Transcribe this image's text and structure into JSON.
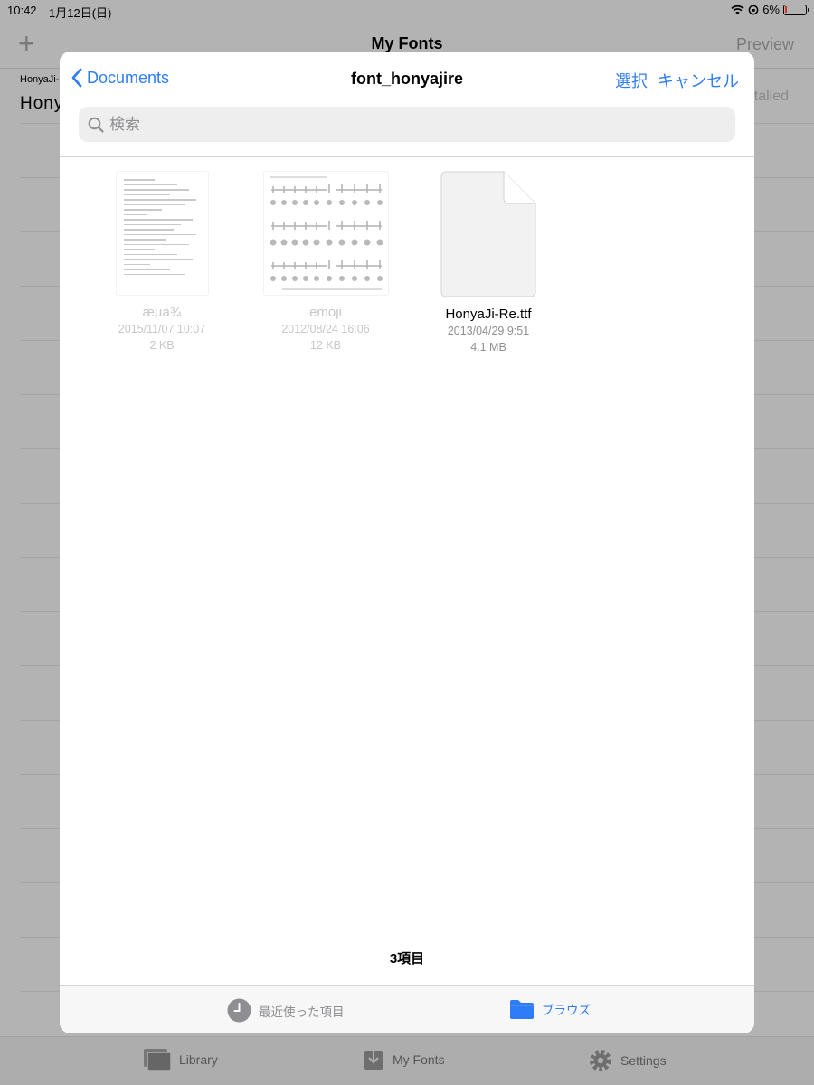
{
  "status_bar": {
    "time": "10:42",
    "date": "1月12日(日)",
    "battery": "6%"
  },
  "background_app": {
    "title": "My Fonts",
    "preview_label": "Preview",
    "row_small": "HonyaJi-",
    "row_big": "Hony",
    "installed_label": "talled",
    "tabs": [
      {
        "label": "Library",
        "icon": "library-icon"
      },
      {
        "label": "My Fonts",
        "icon": "download-icon"
      },
      {
        "label": "Settings",
        "icon": "gear-icon"
      }
    ]
  },
  "picker": {
    "back_label": "Documents",
    "title": "font_honyajire",
    "select_label": "選択",
    "cancel_label": "キャンセル",
    "search_placeholder": "検索",
    "files": [
      {
        "name": "æµà¾",
        "date": "2015/11/07 10:07",
        "size": "2 KB",
        "enabled": false,
        "icon": "text-document-thumbnail"
      },
      {
        "name": "emoji",
        "date": "2012/08/24 16:06",
        "size": "12 KB",
        "enabled": false,
        "icon": "emoji-chart-thumbnail"
      },
      {
        "name": "HonyaJi-Re.ttf",
        "date": "2013/04/29 9:51",
        "size": "4.1 MB",
        "enabled": true,
        "icon": "blank-file-icon"
      }
    ],
    "item_count": "3項目",
    "tabs": [
      {
        "label": "最近使った項目",
        "icon": "clock-icon",
        "active": false
      },
      {
        "label": "ブラウズ",
        "icon": "folder-icon",
        "active": true
      }
    ]
  },
  "colors": {
    "accent": "#2f7df6",
    "dimmed_text": "#c7c7cc",
    "secondary_text": "#8e8e93",
    "overlay": "#b3b3b3"
  }
}
